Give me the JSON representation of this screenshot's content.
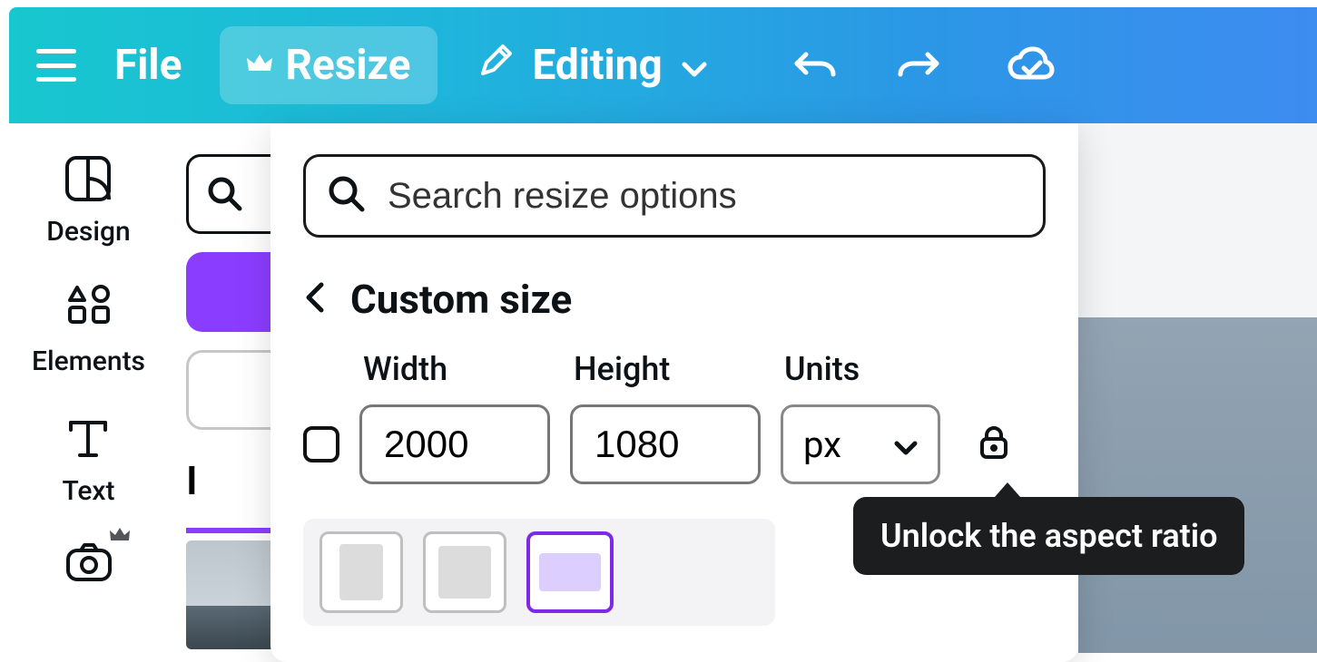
{
  "topbar": {
    "file_label": "File",
    "resize_label": "Resize",
    "editing_label": "Editing"
  },
  "sidebar": {
    "design_label": "Design",
    "elements_label": "Elements",
    "text_label": "Text"
  },
  "panel_behind": {
    "tab_label": "I"
  },
  "resize_panel": {
    "search_placeholder": "Search resize options",
    "custom_title": "Custom size",
    "width_label": "Width",
    "height_label": "Height",
    "units_label": "Units",
    "width_value": "2000",
    "height_value": "1080",
    "units_value": "px"
  },
  "tooltip": {
    "text": "Unlock the aspect ratio"
  }
}
